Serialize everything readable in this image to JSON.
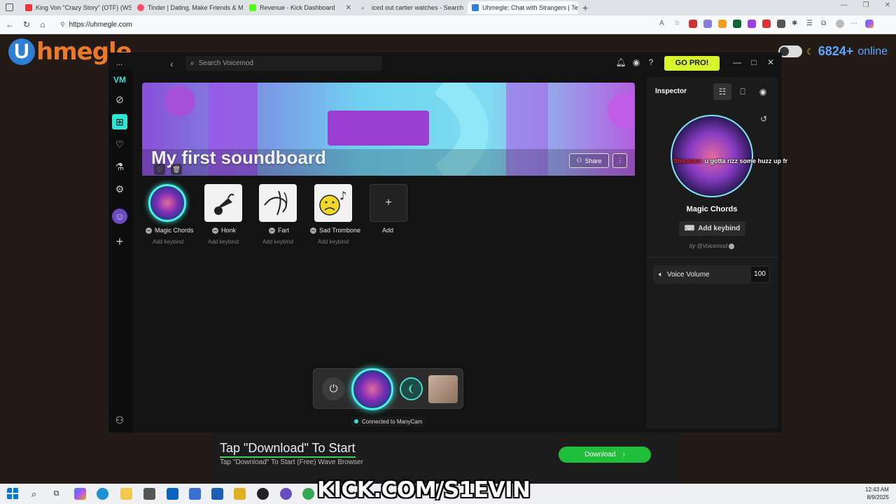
{
  "browser": {
    "tabs": [
      {
        "title": "King Von \"Crazy Story\" (OTF) (WS",
        "color": "#e33"
      },
      {
        "title": "Tinder | Dating, Make Friends & M",
        "color": "#fd4d6a"
      },
      {
        "title": "Revenue - Kick Dashboard",
        "color": "#53fc18"
      },
      {
        "title": "iced out cartier watches - Search",
        "color": "#888"
      },
      {
        "title": "Uhmegle: Chat with Strangers | Te",
        "color": "#2f7fd4"
      }
    ],
    "new_tab": "+",
    "url": "https://uhmegle.com"
  },
  "site": {
    "logo_letter": "U",
    "logo_text": "hmegle",
    "online_count": "6824+",
    "online_label": "online"
  },
  "voicemod": {
    "menu": "...",
    "back": "‹",
    "search_placeholder": "Search Voicemod",
    "go_pro": "GO PRO!",
    "soundboard_title": "My first soundboard",
    "share": "Share",
    "more": "⋮",
    "sounds": [
      {
        "name": "Magic Chords",
        "keybind": "Add keybind"
      },
      {
        "name": "Honk",
        "keybind": "Add keybind"
      },
      {
        "name": "Fart",
        "keybind": "Add keybind"
      },
      {
        "name": "Sad Trombone",
        "keybind": "Add keybind"
      }
    ],
    "add_label": "Add",
    "add_symbol": "+",
    "inspector": {
      "title": "Inspector",
      "overlay_red": "Streamer:",
      "overlay_text": "u gotta rizz some huzz up fr",
      "selected_name": "Magic Chords",
      "add_keybind": "Add keybind",
      "by": "by @Voicemod",
      "volume_label": "Voice Volume",
      "volume_value": "100"
    },
    "connection": "Connected to ManyCam"
  },
  "ad": {
    "title": "Tap \"Download\" To Start",
    "subtitle": "Tap \"Download\" To Start (Free) Wave Browser",
    "button": "Download"
  },
  "overlay": {
    "kick": "KICK.COM/S1EVIN"
  },
  "taskbar": {
    "time": "12:43 AM",
    "date": "8/9/2025"
  }
}
